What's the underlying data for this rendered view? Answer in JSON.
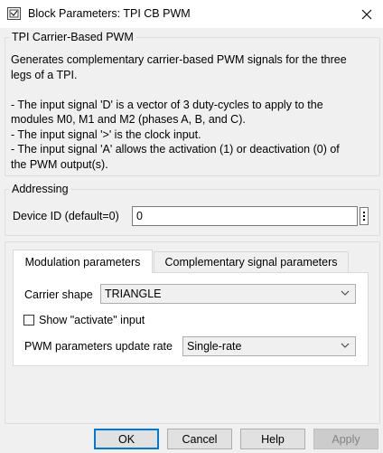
{
  "window": {
    "title": "Block Parameters: TPI CB PWM"
  },
  "mask": {
    "group_title": "TPI Carrier-Based PWM",
    "description": [
      "Generates complementary carrier-based PWM signals for the three",
      "legs of a TPI.",
      "",
      "- The input signal 'D' is a vector of 3 duty-cycles to apply to the",
      "modules M0, M1 and M2 (phases A, B, and C).",
      "- The input signal '>' is the clock input.",
      "- The input signal 'A' allows the activation (1) or deactivation (0) of",
      "the PWM output(s)."
    ]
  },
  "addressing": {
    "group_title": "Addressing",
    "device_id_label": "Device ID (default=0)",
    "device_id_value": "0"
  },
  "tabs": [
    {
      "label": "Modulation parameters",
      "active": true
    },
    {
      "label": "Complementary signal parameters",
      "active": false
    }
  ],
  "modulation": {
    "carrier_shape_label": "Carrier shape",
    "carrier_shape_value": "TRIANGLE",
    "show_activate_label": "Show \"activate\" input",
    "show_activate_checked": false,
    "update_rate_label": "PWM parameters update rate",
    "update_rate_value": "Single-rate"
  },
  "buttons": {
    "ok": "OK",
    "cancel": "Cancel",
    "help": "Help",
    "apply": "Apply"
  }
}
